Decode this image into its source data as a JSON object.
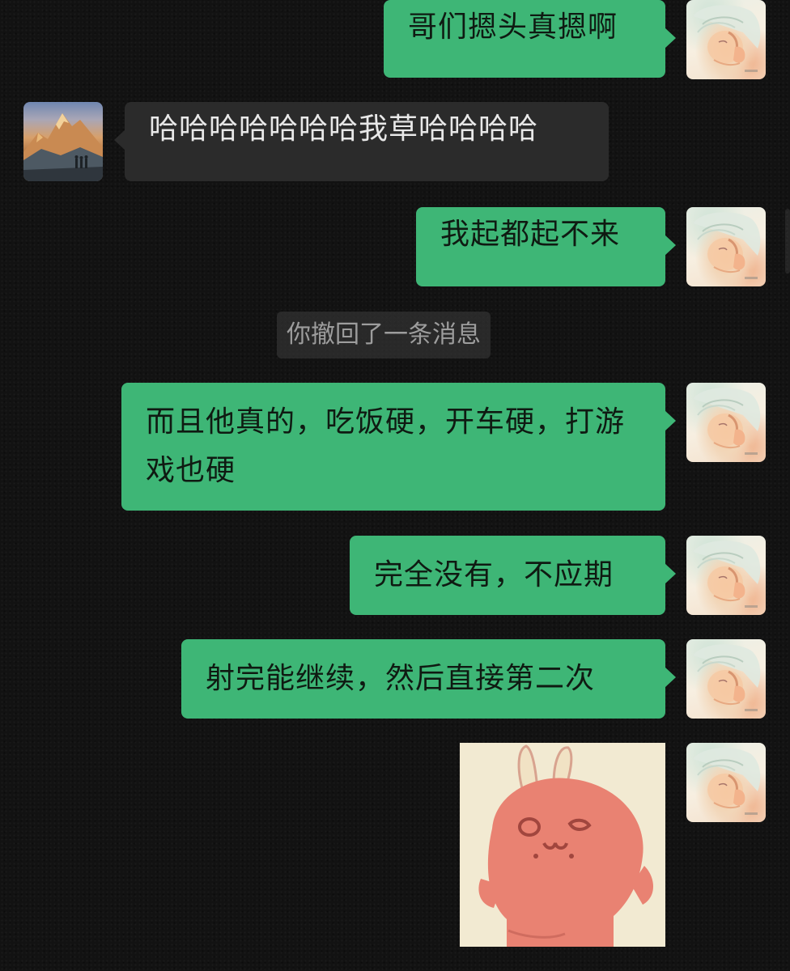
{
  "messages": [
    {
      "side": "sent",
      "text": "哥们摁头真摁啊"
    },
    {
      "side": "received",
      "text": "哈哈哈哈哈哈哈我草哈哈哈哈"
    },
    {
      "side": "sent",
      "text": "我起都起不来"
    },
    {
      "side": "system",
      "text": "你撤回了一条消息"
    },
    {
      "side": "sent",
      "text": "而且他真的，吃饭硬，开车硬，打游戏也硬"
    },
    {
      "side": "sent",
      "text": "完全没有，不应期"
    },
    {
      "side": "sent",
      "text": "射完能继续，然后直接第二次"
    },
    {
      "side": "sent",
      "type": "sticker",
      "sticker": "pink-rabbit-sticker"
    }
  ],
  "avatars": {
    "me": "anime-girl-avatar",
    "friend": "mountain-landscape-avatar"
  },
  "colors": {
    "background": "#121212",
    "sent_bubble": "#3eb676",
    "received_bubble": "#2b2b2b",
    "system_notice_text": "#9d9d9d"
  }
}
